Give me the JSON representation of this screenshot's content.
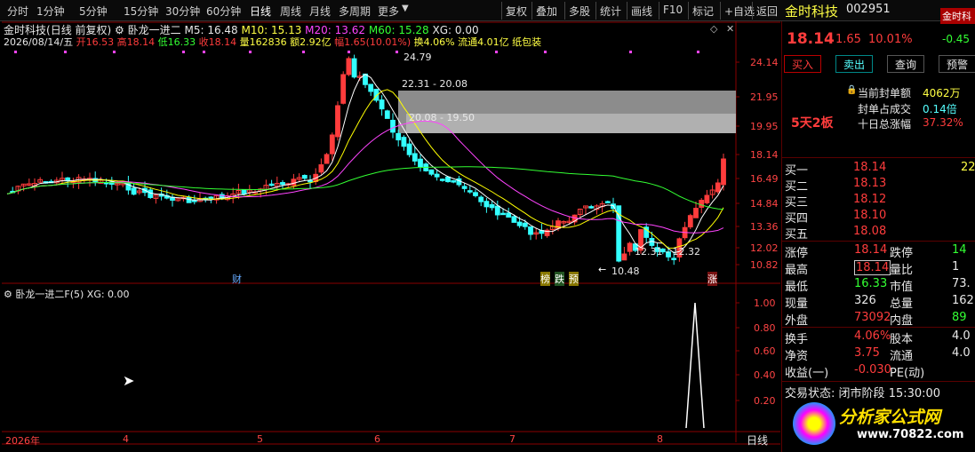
{
  "toolbar": {
    "periods": [
      "分时",
      "1分钟",
      "5分钟",
      "15分钟",
      "30分钟",
      "60分钟",
      "日线",
      "周线",
      "月线",
      "多周期",
      "更多"
    ],
    "active_period": "日线",
    "tools": [
      "复权",
      "叠加",
      "多股",
      "统计",
      "画线",
      "F10",
      "标记",
      "+自选",
      "返回"
    ]
  },
  "chart_header": {
    "stock_name": "金时科技",
    "mode": "(日线 前复权)",
    "indicator": "卧龙一进二",
    "ma5": "M5: 16.48",
    "ma10": "M10: 15.13",
    "ma20": "M20: 13.62",
    "ma60": "M60: 15.28",
    "xg": "XG: 0.00"
  },
  "ohlc_line": {
    "date": "2026/08/14/五",
    "open": "开16.53",
    "high": "高18.14",
    "low": "低16.33",
    "close": "收18.14",
    "volume": "量162836",
    "amount": "额2.92亿",
    "change": "幅1.65(10.01%)",
    "turnover": "换4.06%",
    "float": "流通4.01亿",
    "concept": "纸包装"
  },
  "price_axis": [
    "24.14",
    "21.95",
    "19.95",
    "18.14",
    "16.49",
    "14.84",
    "13.36",
    "12.02",
    "10.82"
  ],
  "annotations": {
    "high_label": "24.79",
    "zone1": "22.31 - 20.08",
    "zone2": "20.08 - 19.50",
    "zone3": "12.31 - 12.32",
    "low_label": "10.48",
    "event_cai": "财",
    "event_bang": "榜",
    "event_die": "跌",
    "event_yu": "预",
    "event_zhang": "涨"
  },
  "sub_chart": {
    "title": "卧龙一进二F(5)",
    "xg": "XG: 0.00",
    "axis": [
      "1.00",
      "0.80",
      "0.60",
      "0.40",
      "0.20"
    ]
  },
  "date_axis": [
    "2026年",
    "4",
    "5",
    "6",
    "7",
    "8"
  ],
  "period_label": "日线",
  "watermark": "分析家公式网www.70822.com",
  "colors": {
    "up": "#ff3c3c",
    "down": "#33ffff",
    "ma5": "#ffffff",
    "ma10": "#ffff00",
    "ma20": "#ff44ff",
    "ma60": "#33ff33"
  },
  "quote": {
    "name": "金时科技",
    "code": "002951",
    "price": "18.14",
    "change": "1.65",
    "pct": "10.01%",
    "buy_btn": "买入",
    "sell_btn": "卖出",
    "query_btn": "查询",
    "alert_btn": "预警",
    "tag": "5天2板",
    "seal_label": "当前封单额",
    "seal_value": "4062万",
    "seal_pct_label": "封单占成交",
    "seal_pct_value": "0.14倍",
    "ten_label": "十日总涨幅",
    "ten_value": "37.32%",
    "bids": [
      {
        "label": "买一",
        "price": "18.14",
        "vol": "22"
      },
      {
        "label": "买二",
        "price": "18.13",
        "vol": ""
      },
      {
        "label": "买三",
        "price": "18.12",
        "vol": ""
      },
      {
        "label": "买四",
        "price": "18.10",
        "vol": ""
      },
      {
        "label": "买五",
        "price": "18.08",
        "vol": ""
      }
    ],
    "stats": [
      {
        "l1": "涨停",
        "v1": "18.14",
        "l2": "跌停",
        "v2": "14"
      },
      {
        "l1": "最高",
        "v1": "18.14",
        "l2": "量比",
        "v2": "1"
      },
      {
        "l1": "最低",
        "v1": "16.33",
        "l2": "市值",
        "v2": "73."
      },
      {
        "l1": "现量",
        "v1": "326",
        "l2": "总量",
        "v2": "162"
      },
      {
        "l1": "外盘",
        "v1": "73092",
        "l2": "内盘",
        "v2": "89"
      }
    ],
    "stats2": [
      {
        "l1": "换手",
        "v1": "4.06%",
        "l2": "股本",
        "v2": "4.0"
      },
      {
        "l1": "净资",
        "v1": "3.75",
        "l2": "流通",
        "v2": "4.0"
      },
      {
        "l1": "收益(一)",
        "v1": "-0.030",
        "l2": "PE(动)",
        "v2": ""
      }
    ],
    "status_label": "交易状态:",
    "status_value": "闭市阶段",
    "time": "15:30:00",
    "logo_text": "分析家公式网",
    "logo_url": "www.70822.com",
    "pct_side": "-0.45",
    "cut_name": "金时科"
  }
}
